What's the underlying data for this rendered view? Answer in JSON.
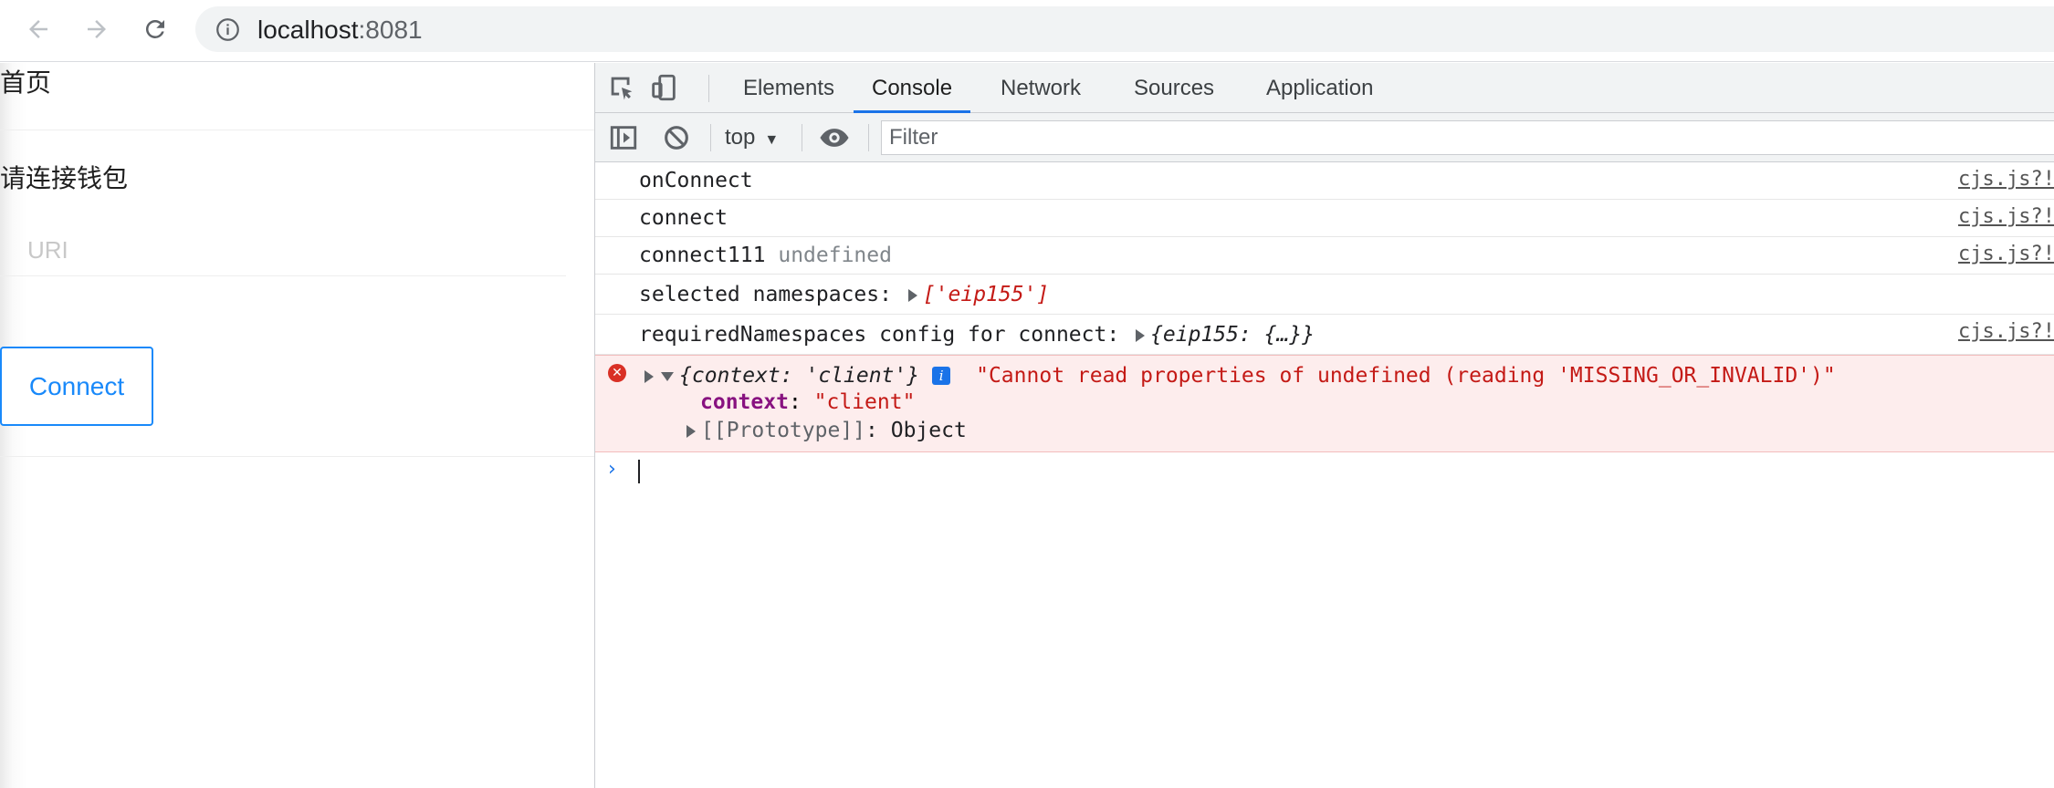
{
  "browser": {
    "url_host": "localhost",
    "url_port": ":8081"
  },
  "page": {
    "title": "首页",
    "section_title": "请连接钱包",
    "uri_placeholder": "URI",
    "connect_label": "Connect"
  },
  "devtools": {
    "tabs": [
      {
        "label": "Elements"
      },
      {
        "label": "Console"
      },
      {
        "label": "Network"
      },
      {
        "label": "Sources"
      },
      {
        "label": "Application"
      }
    ],
    "context_label": "top",
    "filter_placeholder": "Filter",
    "messages": [
      {
        "text": "onConnect",
        "src": "cjs.js?!"
      },
      {
        "text": "connect",
        "src": "cjs.js?!"
      },
      {
        "text": "connect111",
        "extra": "undefined",
        "src": "cjs.js?!"
      },
      {
        "text": "selected namespaces:",
        "value": "['eip155']"
      },
      {
        "text": "requiredNamespaces config for connect:",
        "value": "{eip155: {…}}",
        "src": "cjs.js?!"
      }
    ],
    "error": {
      "object": "{context: 'client'}",
      "message": "\"Cannot read properties of undefined (reading 'MISSING_OR_INVALID')\"",
      "prop_key": "context",
      "prop_value": "\"client\"",
      "proto_key": "[[Prototype]]",
      "proto_value": "Object"
    }
  }
}
